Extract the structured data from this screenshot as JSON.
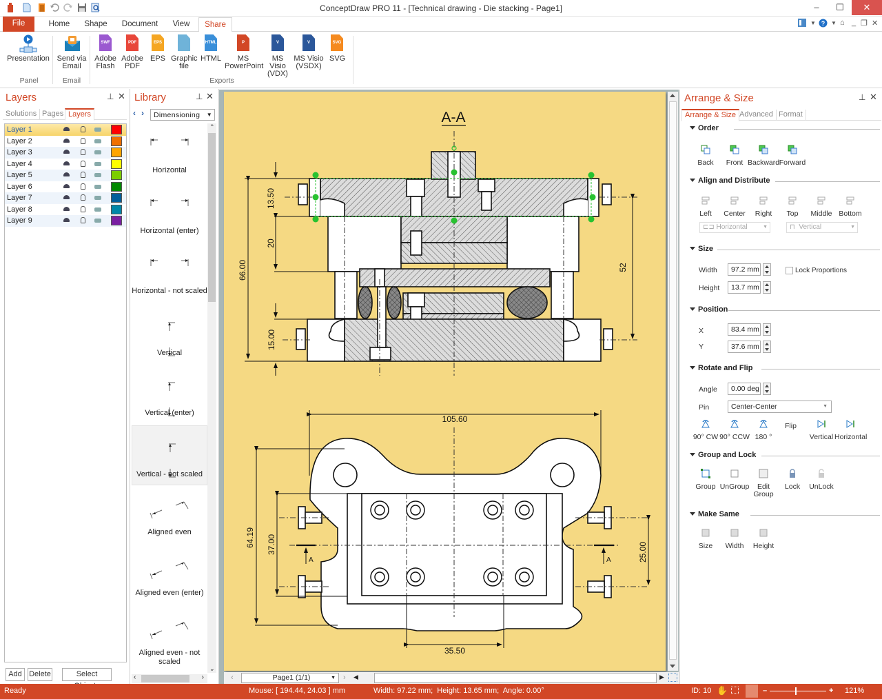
{
  "app": {
    "title": "ConceptDraw PRO 11 - [Technical drawing - Die stacking - Page1]"
  },
  "quick_access": [
    "app-logo-icon",
    "new-document-icon",
    "open-icon",
    "undo-icon",
    "redo-icon",
    "save-icon",
    "print-preview-icon"
  ],
  "tabs": [
    {
      "label": "File",
      "active": false
    },
    {
      "label": "Home",
      "active": false
    },
    {
      "label": "Shape",
      "active": false
    },
    {
      "label": "Document",
      "active": false
    },
    {
      "label": "View",
      "active": false
    },
    {
      "label": "Share",
      "active": true
    }
  ],
  "ribbon": {
    "groups": [
      {
        "label": "Panel"
      },
      {
        "label": "Email"
      },
      {
        "label": "Exports"
      }
    ],
    "buttons": [
      {
        "label": "Presentation",
        "icon": "presentation-icon"
      },
      {
        "label": "Send via\nEmail",
        "l1": "Send via",
        "l2": "Email",
        "icon": "email-icon"
      },
      {
        "l1": "Adobe",
        "l2": "Flash",
        "badge": "SWF",
        "color": "#9b59d0",
        "icon": "swf-file-icon"
      },
      {
        "l1": "Adobe",
        "l2": "PDF",
        "badge": "PDF",
        "color": "#e8473a",
        "icon": "pdf-file-icon"
      },
      {
        "l1": "EPS",
        "l2": "",
        "badge": "EPS",
        "color": "#f5a623",
        "icon": "eps-file-icon"
      },
      {
        "l1": "Graphic",
        "l2": "file",
        "badge": "",
        "color": "#6fb3d9",
        "icon": "image-file-icon"
      },
      {
        "l1": "HTML",
        "l2": "",
        "badge": "HTML",
        "color": "#3a8fd9",
        "icon": "html-file-icon"
      },
      {
        "l1": "MS",
        "l2": "PowerPoint",
        "badge": "P",
        "color": "#d24726",
        "icon": "powerpoint-icon"
      },
      {
        "l1": "MS Visio",
        "l2": "(VDX)",
        "badge": "V",
        "color": "#2b579a",
        "icon": "visio-vdx-icon"
      },
      {
        "l1": "MS Visio",
        "l2": "(VSDX)",
        "badge": "V",
        "color": "#2b579a",
        "icon": "visio-vsdx-icon"
      },
      {
        "l1": "SVG",
        "l2": "",
        "badge": "SVG",
        "color": "#f58a1f",
        "icon": "svg-file-icon"
      }
    ]
  },
  "layers_panel": {
    "title": "Layers",
    "tabs": [
      "Solutions",
      "Pages",
      "Layers"
    ],
    "active_tab": "Layers",
    "layers": [
      {
        "name": "Layer 1",
        "color": "#ff0000",
        "locked": false,
        "selected": true
      },
      {
        "name": "Layer 2",
        "color": "#f07000",
        "locked": false,
        "selected": false
      },
      {
        "name": "Layer 3",
        "color": "#ffa500",
        "locked": false,
        "selected": false
      },
      {
        "name": "Layer 4",
        "color": "#ffff00",
        "locked": false,
        "selected": false
      },
      {
        "name": "Layer 5",
        "color": "#7ccf00",
        "locked": false,
        "selected": false
      },
      {
        "name": "Layer 6",
        "color": "#008a00",
        "locked": false,
        "selected": false
      },
      {
        "name": "Layer 7",
        "color": "#005f9a",
        "locked": false,
        "selected": false
      },
      {
        "name": "Layer 8",
        "color": "#0087a8",
        "locked": false,
        "selected": false
      },
      {
        "name": "Layer 9",
        "color": "#7a1fa2",
        "locked": true,
        "selected": false
      }
    ],
    "buttons": {
      "add": "Add",
      "delete": "Delete",
      "select_objects": "Select Objects"
    }
  },
  "library_panel": {
    "title": "Library",
    "selected_library": "Dimensioning",
    "items": [
      {
        "label": "Horizontal",
        "kind": "h"
      },
      {
        "label": "Horizontal (enter)",
        "kind": "h"
      },
      {
        "label": "Horizontal - not scaled",
        "kind": "h"
      },
      {
        "label": "Vertical",
        "kind": "v"
      },
      {
        "label": "Vertical (enter)",
        "kind": "v"
      },
      {
        "label": "Vertical - not scaled",
        "kind": "v",
        "selected": true
      },
      {
        "label": "Aligned even",
        "kind": "a"
      },
      {
        "label": "Aligned even (enter)",
        "kind": "a"
      },
      {
        "label": "Aligned even - not scaled",
        "kind": "a"
      }
    ]
  },
  "drawing": {
    "section_title": "A-A",
    "dimensions_top": {
      "d1": "13.50",
      "d2": "20",
      "d3": "66.00",
      "d4": "15.00",
      "d5": "52"
    },
    "dimensions_bottom": {
      "width": "105.60",
      "height": "64.19",
      "inner": "37.00",
      "right": "25.00",
      "bottom": "35.50",
      "section_mark": "A"
    },
    "background_color": "#f5d983"
  },
  "page_nav": {
    "page_label": "Page1 (1/1)"
  },
  "arrange_panel": {
    "title": "Arrange & Size",
    "tabs": [
      "Arrange & Size",
      "Advanced",
      "Format"
    ],
    "active_tab": "Arrange & Size",
    "order": {
      "title": "Order",
      "buttons": [
        "Back",
        "Front",
        "Backward",
        "Forward"
      ]
    },
    "align": {
      "title": "Align and Distribute",
      "buttons": [
        "Left",
        "Center",
        "Right",
        "Top",
        "Middle",
        "Bottom"
      ],
      "horizontal": "Horizontal",
      "vertical": "Vertical"
    },
    "size": {
      "title": "Size",
      "width_label": "Width",
      "width": "97.2 mm",
      "height_label": "Height",
      "height": "13.7 mm",
      "lock_label": "Lock Proportions",
      "lock_checked": false
    },
    "position": {
      "title": "Position",
      "x_label": "X",
      "x": "83.4 mm",
      "y_label": "Y",
      "y": "37.6 mm"
    },
    "rotate": {
      "title": "Rotate and Flip",
      "angle_label": "Angle",
      "angle": "0.00 deg",
      "pin_label": "Pin",
      "pin": "Center-Center",
      "buttons": [
        "90° CW",
        "90° CCW",
        "180 °"
      ],
      "flip_label": "Flip",
      "flip_buttons": [
        "Vertical",
        "Horizontal"
      ]
    },
    "group": {
      "title": "Group and Lock",
      "buttons": [
        "Group",
        "UnGroup",
        "Edit\nGroup",
        "Lock",
        "UnLock"
      ],
      "edit1": "Edit",
      "edit2": "Group"
    },
    "make_same": {
      "title": "Make Same",
      "buttons": [
        "Size",
        "Width",
        "Height"
      ]
    }
  },
  "status": {
    "state": "Ready",
    "mouse": "Mouse: [ 194.44, 24.03 ] mm",
    "dims": "Width: 97.22 mm;  Height: 13.65 mm;  Angle: 0.00°",
    "id": "ID: 10",
    "zoom": "121%",
    "zoom_slider_fraction": 0.45
  }
}
